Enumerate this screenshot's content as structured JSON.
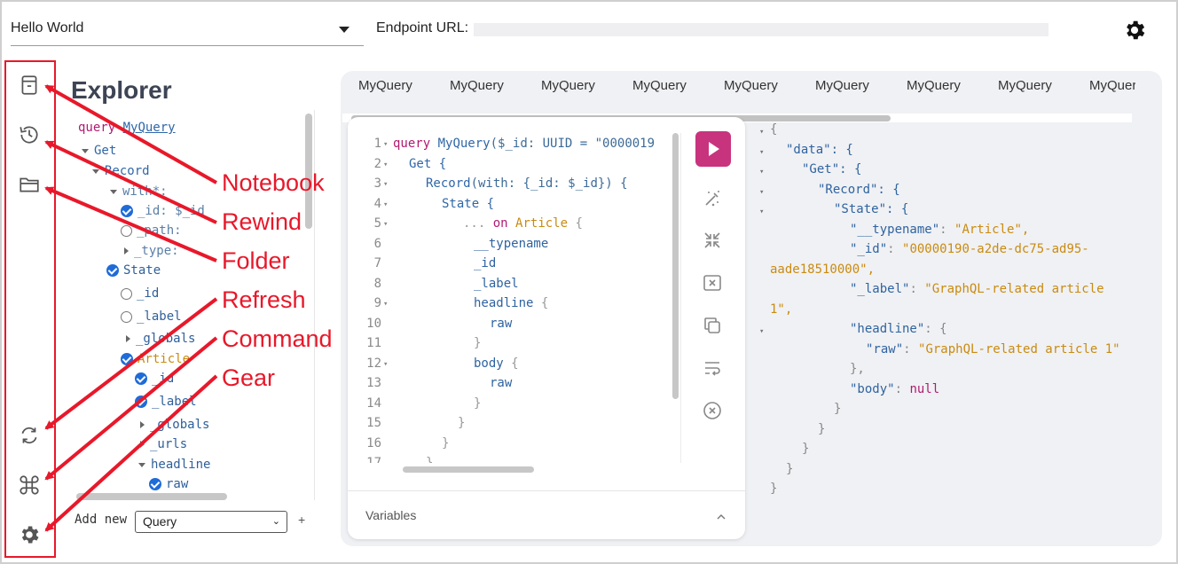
{
  "header": {
    "project": "Hello World",
    "endpoint_label": "Endpoint URL:",
    "endpoint_value": ""
  },
  "sidebar": {
    "icons": [
      "notebook-icon",
      "history-icon",
      "folder-icon",
      "refresh-icon",
      "command-icon",
      "gear-icon"
    ]
  },
  "annotations": [
    "Notebook",
    "Rewind",
    "Folder",
    "Refresh",
    "Command",
    "Gear"
  ],
  "accent_color": "#e8182a",
  "explorer": {
    "title": "Explorer",
    "query_keyword": "query",
    "query_name": "MyQuery",
    "rows": [
      "Get",
      "Record",
      "with*:",
      "_id: $_id",
      "_path:",
      "_type:",
      "State",
      "_id",
      "_label",
      "_globals",
      "Article",
      "_id",
      "_label",
      "_globals",
      "_urls",
      "headline",
      "raw"
    ],
    "add_new_label": "Add new",
    "add_new_option": "Query",
    "add_plus": "+"
  },
  "tabs": [
    "MyQuery",
    "MyQuery",
    "MyQuery",
    "MyQuery",
    "MyQuery",
    "MyQuery",
    "MyQuery",
    "MyQuery",
    "MyQuer"
  ],
  "editor": {
    "line_numbers": [
      "1",
      "2",
      "3",
      "4",
      "5",
      "6",
      "7",
      "8",
      "9",
      "10",
      "11",
      "12",
      "13",
      "14",
      "15",
      "16",
      "17"
    ],
    "code": {
      "l1_kw": "query",
      "l1_name": "MyQuery",
      "l1_rest": "($_id: UUID = \"0000019",
      "l2": "Get {",
      "l3_fn": "Record",
      "l3_rest": "(with: {_id: $_id}) {",
      "l4": "State {",
      "l5_dots": "...",
      "l5_kw": "on",
      "l5_type": "Article",
      "l5_brace": "{",
      "l6": "__typename",
      "l7": "_id",
      "l8": "_label",
      "l9": "headline",
      "l9_brace": "{",
      "l10": "raw",
      "l11": "}",
      "l12": "body",
      "l12_brace": "{",
      "l13": "raw",
      "l14": "}",
      "l15": "}",
      "l16": "}",
      "l17": "}"
    },
    "variables_label": "Variables"
  },
  "result": {
    "lines": [
      "{",
      "\"data\": {",
      "\"Get\": {",
      "\"Record\": {",
      "\"State\": {",
      "\"__typename\"",
      "\"Article\",",
      "\"_id\"",
      "\"00000190-a2de-dc75-ad95-",
      "aade18510000\",",
      "\"_label\"",
      "\"GraphQL-related article",
      "1\",",
      "\"headline\"",
      "{",
      "\"raw\"",
      "\"GraphQL-related article 1\"",
      "},",
      "\"body\"",
      "null",
      "}",
      "}",
      "}",
      "}",
      "}"
    ]
  }
}
